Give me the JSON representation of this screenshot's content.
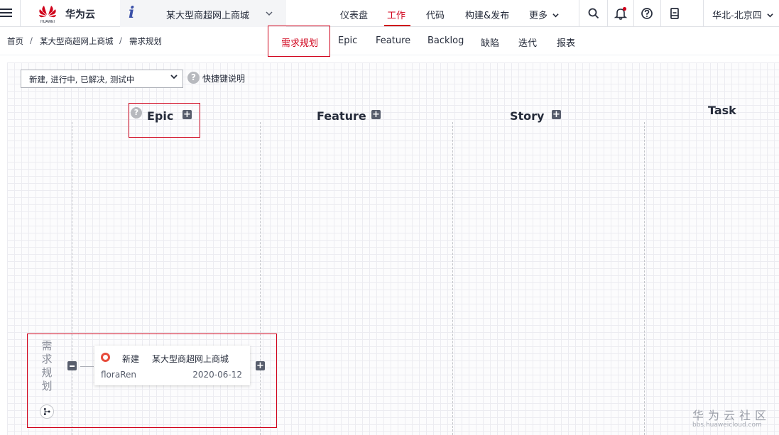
{
  "topbar": {
    "brand_name": "华为云",
    "logo_caption": "HUAWEI",
    "project_name": "某大型商超网上商城",
    "nav": [
      "仪表盘",
      "工作",
      "代码",
      "构建&发布",
      "更多"
    ],
    "active_nav": "工作",
    "region": "华北-北京四"
  },
  "breadcrumb": [
    "首页",
    "某大型商超网上商城",
    "需求规划"
  ],
  "subtabs": [
    "需求规划",
    "Epic",
    "Feature",
    "Backlog",
    "缺陷",
    "迭代",
    "报表"
  ],
  "active_subtab": "需求规划",
  "filter": {
    "value": "新建, 进行中, 已解决, 测试中"
  },
  "shortcut_label": "快捷键说明",
  "columns": [
    "Epic",
    "Feature",
    "Story",
    "Task"
  ],
  "root_label": "需求规划",
  "card": {
    "status": "新建",
    "title": "某大型商超网上商城",
    "assignee": "floraRen",
    "date": "2020-06-12"
  },
  "watermark": {
    "title": "华为云社区",
    "url": "bbs.huaweicloud.com"
  },
  "colors": {
    "accent_red": "#d0021b",
    "status_new": "#e74c3c"
  }
}
